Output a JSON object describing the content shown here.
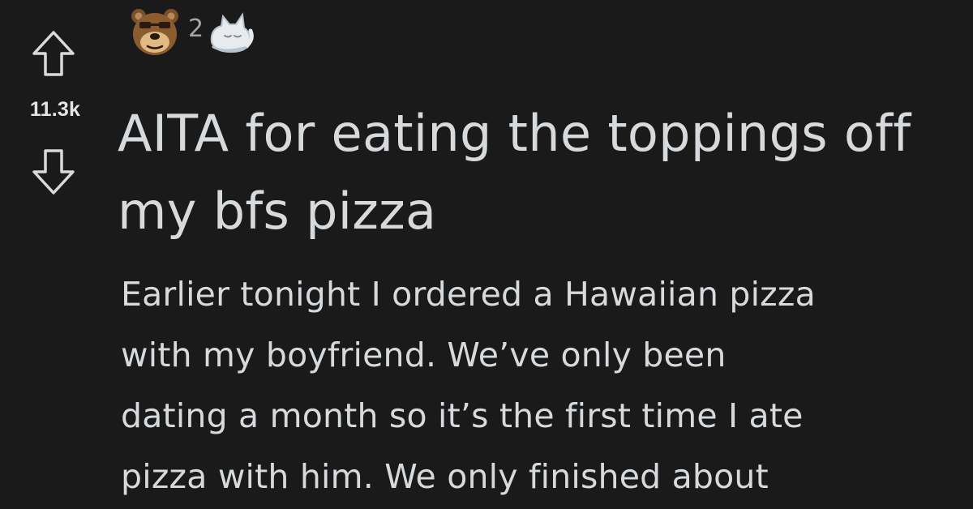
{
  "post": {
    "score": "11.3k",
    "awards": {
      "items": [
        {
          "icon": "bear-face-icon"
        },
        {
          "icon": "sleeping-cat-icon"
        }
      ],
      "count": "2"
    },
    "title": "AITA for eating the toppings off my bfs pizza",
    "body_lines": [
      "Earlier tonight I ordered a Hawaiian pizza",
      "with my boyfriend. We’ve only been",
      "dating a month so it’s the first time I ate",
      "pizza with him. We only finished about"
    ]
  },
  "icons": {
    "upvote": "arrow-up-outline-icon",
    "downvote": "arrow-down-outline-icon"
  },
  "colors": {
    "background": "#1a1a1b",
    "text": "#d7dadc",
    "muted": "#a4a7aa"
  }
}
